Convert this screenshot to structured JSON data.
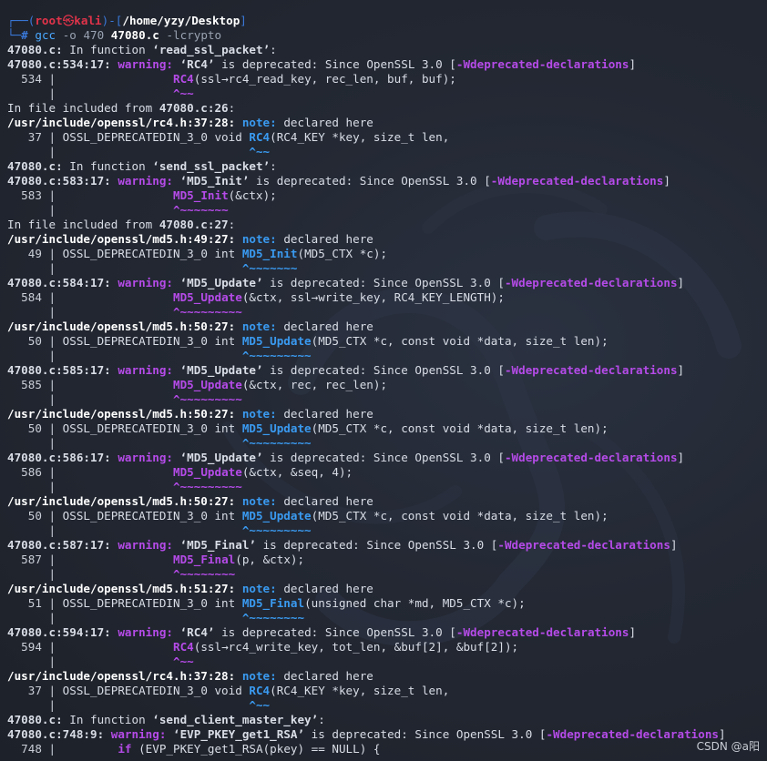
{
  "prompt": {
    "user": "root",
    "skull": "㉿",
    "host": "kali",
    "dir": "/home/yzy/Desktop",
    "hash": "#",
    "cmd": "gcc",
    "args1": " -o 470 ",
    "file": "47080.c",
    "args2": " -lcrypto"
  },
  "lines": [
    [
      {
        "t": "47080.c:",
        "c": "b"
      },
      {
        "t": " In function "
      },
      {
        "t": "‘read_ssl_packet’",
        "c": "b"
      },
      {
        "t": ":"
      }
    ],
    [
      {
        "t": "47080.c:534:17:",
        "c": "b"
      },
      {
        "t": " "
      },
      {
        "t": "warning:",
        "c": "warn"
      },
      {
        "t": " "
      },
      {
        "t": "‘RC4’",
        "c": "b"
      },
      {
        "t": " is deprecated: Since OpenSSL 3.0 ["
      },
      {
        "t": "-Wdeprecated-declarations",
        "c": "warn"
      },
      {
        "t": "]"
      }
    ],
    [
      {
        "t": "  534 | ",
        "c": "gutter"
      },
      {
        "t": "                "
      },
      {
        "t": "RC4",
        "c": "hl-p"
      },
      {
        "t": "(ssl→rc4_read_key, rec_len, buf, buf);"
      }
    ],
    [
      {
        "t": "      | ",
        "c": "gutter"
      },
      {
        "t": "                "
      },
      {
        "t": "^~~",
        "c": "caret-p"
      }
    ],
    [
      {
        "t": "In file included from "
      },
      {
        "t": "47080.c:26",
        "c": "b"
      },
      {
        "t": ":"
      }
    ],
    [
      {
        "t": "/usr/include/openssl/rc4.h:37:28:",
        "c": "path"
      },
      {
        "t": " "
      },
      {
        "t": "note:",
        "c": "note"
      },
      {
        "t": " declared here"
      }
    ],
    [
      {
        "t": "   37 | ",
        "c": "gutter"
      },
      {
        "t": "OSSL_DEPRECATEDIN_3_0 void "
      },
      {
        "t": "RC4",
        "c": "hl-b"
      },
      {
        "t": "(RC4_KEY *key, size_t len,"
      }
    ],
    [
      {
        "t": "      | ",
        "c": "gutter"
      },
      {
        "t": "                           "
      },
      {
        "t": "^~~",
        "c": "caret-b"
      }
    ],
    [
      {
        "t": "47080.c:",
        "c": "b"
      },
      {
        "t": " In function "
      },
      {
        "t": "‘send_ssl_packet’",
        "c": "b"
      },
      {
        "t": ":"
      }
    ],
    [
      {
        "t": "47080.c:583:17:",
        "c": "b"
      },
      {
        "t": " "
      },
      {
        "t": "warning:",
        "c": "warn"
      },
      {
        "t": " "
      },
      {
        "t": "‘MD5_Init’",
        "c": "b"
      },
      {
        "t": " is deprecated: Since OpenSSL 3.0 ["
      },
      {
        "t": "-Wdeprecated-declarations",
        "c": "warn"
      },
      {
        "t": "]"
      }
    ],
    [
      {
        "t": "  583 | ",
        "c": "gutter"
      },
      {
        "t": "                "
      },
      {
        "t": "MD5_Init",
        "c": "hl-p"
      },
      {
        "t": "(&ctx);"
      }
    ],
    [
      {
        "t": "      | ",
        "c": "gutter"
      },
      {
        "t": "                "
      },
      {
        "t": "^~~~~~~~",
        "c": "caret-p"
      }
    ],
    [
      {
        "t": "In file included from "
      },
      {
        "t": "47080.c:27",
        "c": "b"
      },
      {
        "t": ":"
      }
    ],
    [
      {
        "t": "/usr/include/openssl/md5.h:49:27:",
        "c": "path"
      },
      {
        "t": " "
      },
      {
        "t": "note:",
        "c": "note"
      },
      {
        "t": " declared here"
      }
    ],
    [
      {
        "t": "   49 | ",
        "c": "gutter"
      },
      {
        "t": "OSSL_DEPRECATEDIN_3_0 int "
      },
      {
        "t": "MD5_Init",
        "c": "hl-b"
      },
      {
        "t": "(MD5_CTX *c);"
      }
    ],
    [
      {
        "t": "      | ",
        "c": "gutter"
      },
      {
        "t": "                          "
      },
      {
        "t": "^~~~~~~~",
        "c": "caret-b"
      }
    ],
    [
      {
        "t": "47080.c:584:17:",
        "c": "b"
      },
      {
        "t": " "
      },
      {
        "t": "warning:",
        "c": "warn"
      },
      {
        "t": " "
      },
      {
        "t": "‘MD5_Update’",
        "c": "b"
      },
      {
        "t": " is deprecated: Since OpenSSL 3.0 ["
      },
      {
        "t": "-Wdeprecated-declarations",
        "c": "warn"
      },
      {
        "t": "]"
      }
    ],
    [
      {
        "t": "  584 | ",
        "c": "gutter"
      },
      {
        "t": "                "
      },
      {
        "t": "MD5_Update",
        "c": "hl-p"
      },
      {
        "t": "(&ctx, ssl→write_key, RC4_KEY_LENGTH);"
      }
    ],
    [
      {
        "t": "      | ",
        "c": "gutter"
      },
      {
        "t": "                "
      },
      {
        "t": "^~~~~~~~~~",
        "c": "caret-p"
      }
    ],
    [
      {
        "t": "/usr/include/openssl/md5.h:50:27:",
        "c": "path"
      },
      {
        "t": " "
      },
      {
        "t": "note:",
        "c": "note"
      },
      {
        "t": " declared here"
      }
    ],
    [
      {
        "t": "   50 | ",
        "c": "gutter"
      },
      {
        "t": "OSSL_DEPRECATEDIN_3_0 int "
      },
      {
        "t": "MD5_Update",
        "c": "hl-b"
      },
      {
        "t": "(MD5_CTX *c, const void *data, size_t len);"
      }
    ],
    [
      {
        "t": "      | ",
        "c": "gutter"
      },
      {
        "t": "                          "
      },
      {
        "t": "^~~~~~~~~~",
        "c": "caret-b"
      }
    ],
    [
      {
        "t": "47080.c:585:17:",
        "c": "b"
      },
      {
        "t": " "
      },
      {
        "t": "warning:",
        "c": "warn"
      },
      {
        "t": " "
      },
      {
        "t": "‘MD5_Update’",
        "c": "b"
      },
      {
        "t": " is deprecated: Since OpenSSL 3.0 ["
      },
      {
        "t": "-Wdeprecated-declarations",
        "c": "warn"
      },
      {
        "t": "]"
      }
    ],
    [
      {
        "t": "  585 | ",
        "c": "gutter"
      },
      {
        "t": "                "
      },
      {
        "t": "MD5_Update",
        "c": "hl-p"
      },
      {
        "t": "(&ctx, rec, rec_len);"
      }
    ],
    [
      {
        "t": "      | ",
        "c": "gutter"
      },
      {
        "t": "                "
      },
      {
        "t": "^~~~~~~~~~",
        "c": "caret-p"
      }
    ],
    [
      {
        "t": "/usr/include/openssl/md5.h:50:27:",
        "c": "path"
      },
      {
        "t": " "
      },
      {
        "t": "note:",
        "c": "note"
      },
      {
        "t": " declared here"
      }
    ],
    [
      {
        "t": "   50 | ",
        "c": "gutter"
      },
      {
        "t": "OSSL_DEPRECATEDIN_3_0 int "
      },
      {
        "t": "MD5_Update",
        "c": "hl-b"
      },
      {
        "t": "(MD5_CTX *c, const void *data, size_t len);"
      }
    ],
    [
      {
        "t": "      | ",
        "c": "gutter"
      },
      {
        "t": "                          "
      },
      {
        "t": "^~~~~~~~~~",
        "c": "caret-b"
      }
    ],
    [
      {
        "t": "47080.c:586:17:",
        "c": "b"
      },
      {
        "t": " "
      },
      {
        "t": "warning:",
        "c": "warn"
      },
      {
        "t": " "
      },
      {
        "t": "‘MD5_Update’",
        "c": "b"
      },
      {
        "t": " is deprecated: Since OpenSSL 3.0 ["
      },
      {
        "t": "-Wdeprecated-declarations",
        "c": "warn"
      },
      {
        "t": "]"
      }
    ],
    [
      {
        "t": "  586 | ",
        "c": "gutter"
      },
      {
        "t": "                "
      },
      {
        "t": "MD5_Update",
        "c": "hl-p"
      },
      {
        "t": "(&ctx, &seq, 4);"
      }
    ],
    [
      {
        "t": "      | ",
        "c": "gutter"
      },
      {
        "t": "                "
      },
      {
        "t": "^~~~~~~~~~",
        "c": "caret-p"
      }
    ],
    [
      {
        "t": "/usr/include/openssl/md5.h:50:27:",
        "c": "path"
      },
      {
        "t": " "
      },
      {
        "t": "note:",
        "c": "note"
      },
      {
        "t": " declared here"
      }
    ],
    [
      {
        "t": "   50 | ",
        "c": "gutter"
      },
      {
        "t": "OSSL_DEPRECATEDIN_3_0 int "
      },
      {
        "t": "MD5_Update",
        "c": "hl-b"
      },
      {
        "t": "(MD5_CTX *c, const void *data, size_t len);"
      }
    ],
    [
      {
        "t": "      | ",
        "c": "gutter"
      },
      {
        "t": "                          "
      },
      {
        "t": "^~~~~~~~~~",
        "c": "caret-b"
      }
    ],
    [
      {
        "t": "47080.c:587:17:",
        "c": "b"
      },
      {
        "t": " "
      },
      {
        "t": "warning:",
        "c": "warn"
      },
      {
        "t": " "
      },
      {
        "t": "‘MD5_Final’",
        "c": "b"
      },
      {
        "t": " is deprecated: Since OpenSSL 3.0 ["
      },
      {
        "t": "-Wdeprecated-declarations",
        "c": "warn"
      },
      {
        "t": "]"
      }
    ],
    [
      {
        "t": "  587 | ",
        "c": "gutter"
      },
      {
        "t": "                "
      },
      {
        "t": "MD5_Final",
        "c": "hl-p"
      },
      {
        "t": "(p, &ctx);"
      }
    ],
    [
      {
        "t": "      | ",
        "c": "gutter"
      },
      {
        "t": "                "
      },
      {
        "t": "^~~~~~~~~",
        "c": "caret-p"
      }
    ],
    [
      {
        "t": "/usr/include/openssl/md5.h:51:27:",
        "c": "path"
      },
      {
        "t": " "
      },
      {
        "t": "note:",
        "c": "note"
      },
      {
        "t": " declared here"
      }
    ],
    [
      {
        "t": "   51 | ",
        "c": "gutter"
      },
      {
        "t": "OSSL_DEPRECATEDIN_3_0 int "
      },
      {
        "t": "MD5_Final",
        "c": "hl-b"
      },
      {
        "t": "(unsigned char *md, MD5_CTX *c);"
      }
    ],
    [
      {
        "t": "      | ",
        "c": "gutter"
      },
      {
        "t": "                          "
      },
      {
        "t": "^~~~~~~~~",
        "c": "caret-b"
      }
    ],
    [
      {
        "t": "47080.c:594:17:",
        "c": "b"
      },
      {
        "t": " "
      },
      {
        "t": "warning:",
        "c": "warn"
      },
      {
        "t": " "
      },
      {
        "t": "‘RC4’",
        "c": "b"
      },
      {
        "t": " is deprecated: Since OpenSSL 3.0 ["
      },
      {
        "t": "-Wdeprecated-declarations",
        "c": "warn"
      },
      {
        "t": "]"
      }
    ],
    [
      {
        "t": "  594 | ",
        "c": "gutter"
      },
      {
        "t": "                "
      },
      {
        "t": "RC4",
        "c": "hl-p"
      },
      {
        "t": "(ssl→rc4_write_key, tot_len, &buf[2], &buf[2]);"
      }
    ],
    [
      {
        "t": "      | ",
        "c": "gutter"
      },
      {
        "t": "                "
      },
      {
        "t": "^~~",
        "c": "caret-p"
      }
    ],
    [
      {
        "t": "/usr/include/openssl/rc4.h:37:28:",
        "c": "path"
      },
      {
        "t": " "
      },
      {
        "t": "note:",
        "c": "note"
      },
      {
        "t": " declared here"
      }
    ],
    [
      {
        "t": "   37 | ",
        "c": "gutter"
      },
      {
        "t": "OSSL_DEPRECATEDIN_3_0 void "
      },
      {
        "t": "RC4",
        "c": "hl-b"
      },
      {
        "t": "(RC4_KEY *key, size_t len,"
      }
    ],
    [
      {
        "t": "      | ",
        "c": "gutter"
      },
      {
        "t": "                           "
      },
      {
        "t": "^~~",
        "c": "caret-b"
      }
    ],
    [
      {
        "t": "47080.c:",
        "c": "b"
      },
      {
        "t": " In function "
      },
      {
        "t": "‘send_client_master_key’",
        "c": "b"
      },
      {
        "t": ":"
      }
    ],
    [
      {
        "t": "47080.c:748:9:",
        "c": "b"
      },
      {
        "t": " "
      },
      {
        "t": "warning:",
        "c": "warn"
      },
      {
        "t": " "
      },
      {
        "t": "‘EVP_PKEY_get1_RSA’",
        "c": "b"
      },
      {
        "t": " is deprecated: Since OpenSSL 3.0 ["
      },
      {
        "t": "-Wdeprecated-declarations",
        "c": "warn"
      },
      {
        "t": "]"
      }
    ],
    [
      {
        "t": "  748 | ",
        "c": "gutter"
      },
      {
        "t": "        "
      },
      {
        "t": "if",
        "c": "hl-p"
      },
      {
        "t": " (EVP_PKEY_get1_RSA(pkey) == NULL) {"
      }
    ]
  ],
  "watermark": "CSDN @a阳",
  "colors": {
    "warning": "#b54be8",
    "note": "#3a9af0",
    "prompt_user": "#e0334a",
    "prompt_frame": "#3a78d8",
    "background": "#232833"
  }
}
